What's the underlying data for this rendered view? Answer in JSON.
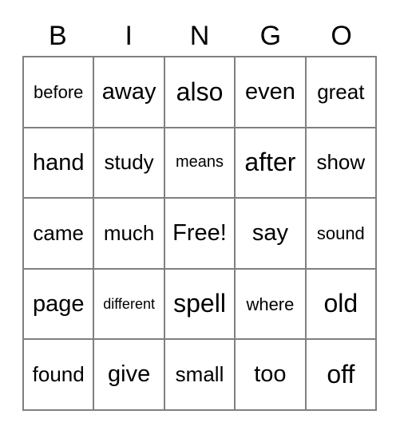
{
  "card": {
    "type": "bingo-card",
    "columns": 5,
    "rows": 5,
    "border_color": "#808080",
    "text_color": "#000000",
    "background_color": "#ffffff"
  },
  "header": {
    "letters": [
      "B",
      "I",
      "N",
      "G",
      "O"
    ]
  },
  "grid": {
    "rows": [
      [
        {
          "text": "before",
          "size": "fs-md"
        },
        {
          "text": "away",
          "size": "fs-xl"
        },
        {
          "text": "also",
          "size": "fs-xxl"
        },
        {
          "text": "even",
          "size": "fs-xl"
        },
        {
          "text": "great",
          "size": "fs-lg"
        }
      ],
      [
        {
          "text": "hand",
          "size": "fs-xl"
        },
        {
          "text": "study",
          "size": "fs-lg"
        },
        {
          "text": "means",
          "size": "fs-sm"
        },
        {
          "text": "after",
          "size": "fs-xxl"
        },
        {
          "text": "show",
          "size": "fs-lg"
        }
      ],
      [
        {
          "text": "came",
          "size": "fs-lg"
        },
        {
          "text": "much",
          "size": "fs-lg"
        },
        {
          "text": "Free!",
          "size": "fs-xl"
        },
        {
          "text": "say",
          "size": "fs-xl"
        },
        {
          "text": "sound",
          "size": "fs-md"
        }
      ],
      [
        {
          "text": "page",
          "size": "fs-xl"
        },
        {
          "text": "different",
          "size": "fs-xs"
        },
        {
          "text": "spell",
          "size": "fs-xxl"
        },
        {
          "text": "where",
          "size": "fs-md"
        },
        {
          "text": "old",
          "size": "fs-xxl"
        }
      ],
      [
        {
          "text": "found",
          "size": "fs-lg"
        },
        {
          "text": "give",
          "size": "fs-xl"
        },
        {
          "text": "small",
          "size": "fs-lg"
        },
        {
          "text": "too",
          "size": "fs-xl"
        },
        {
          "text": "off",
          "size": "fs-xxl"
        }
      ]
    ]
  }
}
